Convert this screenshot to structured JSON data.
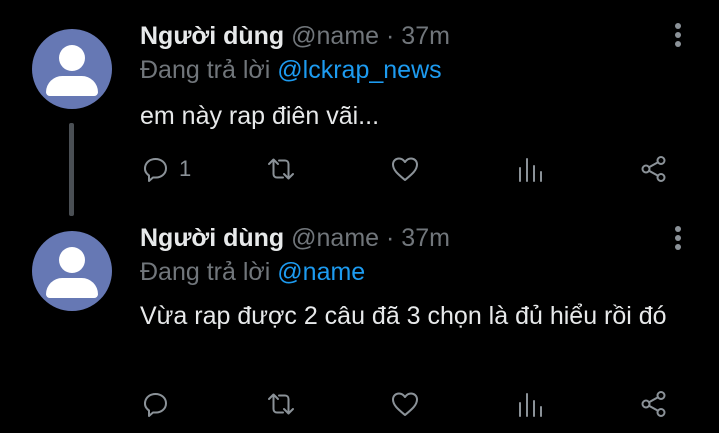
{
  "tweets": [
    {
      "display_name": "Người dùng",
      "handle": "@name",
      "separator": "·",
      "time": "37m",
      "replying_prefix": "Đang trả lời",
      "replying_to": "@lckrap_news",
      "text": "em này rap điên vãi...",
      "reply_count": "1"
    },
    {
      "display_name": "Người dùng",
      "handle": "@name",
      "separator": "·",
      "time": "37m",
      "replying_prefix": "Đang trả lời",
      "replying_to": "@name",
      "text": "Vừa rap được 2 câu đã 3 chọn là đủ hiểu rồi đó",
      "reply_count": ""
    }
  ],
  "icons": {
    "reply": "reply-icon",
    "retweet": "retweet-icon",
    "like": "heart-icon",
    "stats": "stats-icon",
    "share": "share-icon",
    "more": "more-vertical-icon"
  },
  "colors": {
    "background": "#000000",
    "primary_text": "#e7e9ea",
    "secondary_text": "#71767b",
    "link": "#1d9bf0",
    "avatar_bg": "#6678b4",
    "thread_line": "#4a4f54"
  }
}
